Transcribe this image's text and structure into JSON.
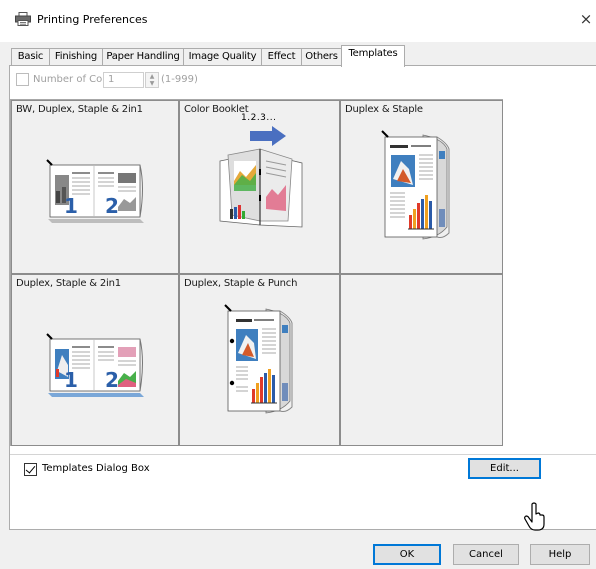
{
  "window": {
    "title": "Printing Preferences",
    "close_glyph": "×",
    "icon": "printer-icon"
  },
  "tabs": [
    {
      "label": "Basic",
      "active": false
    },
    {
      "label": "Finishing",
      "active": false
    },
    {
      "label": "Paper Handling",
      "active": false
    },
    {
      "label": "Image Quality",
      "active": false
    },
    {
      "label": "Effect",
      "active": false
    },
    {
      "label": "Others",
      "active": false
    },
    {
      "label": "Templates",
      "active": true
    }
  ],
  "copies": {
    "label": "Number of Copies:",
    "value": "1",
    "range": "(1-999)",
    "enabled": false
  },
  "templates": [
    {
      "label": "BW, Duplex, Staple & 2in1",
      "icon": "bw-duplex-staple-2in1-icon"
    },
    {
      "label": "Color Booklet",
      "icon": "color-booklet-icon",
      "sub_label": "1.2.3..."
    },
    {
      "label": "Duplex & Staple",
      "icon": "duplex-staple-icon"
    },
    {
      "label": "Duplex, Staple & 2in1",
      "icon": "duplex-staple-2in1-icon"
    },
    {
      "label": "Duplex, Staple & Punch",
      "icon": "duplex-staple-punch-icon"
    },
    {
      "label": "",
      "icon": ""
    }
  ],
  "templates_dialog_box": {
    "label": "Templates Dialog Box",
    "checked": true
  },
  "buttons": {
    "edit": "Edit...",
    "ok": "OK",
    "cancel": "Cancel",
    "help": "Help"
  },
  "colors": {
    "accent": "#0078d7",
    "panel_bg": "#f0f0f0"
  }
}
